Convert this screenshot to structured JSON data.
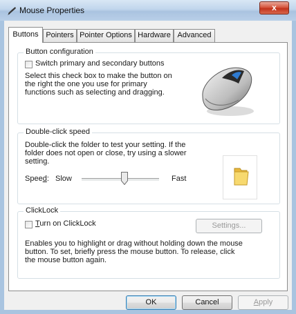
{
  "window": {
    "title": "Mouse Properties",
    "close_label": "x"
  },
  "tabs": [
    {
      "label": "Buttons",
      "active": true
    },
    {
      "label": "Pointers",
      "active": false
    },
    {
      "label": "Pointer Options",
      "active": false
    },
    {
      "label": "Hardware",
      "active": false
    },
    {
      "label": "Advanced",
      "active": false
    }
  ],
  "button_configuration": {
    "title": "Button configuration",
    "checkbox_label": "Switch primary and secondary buttons",
    "checkbox_checked": false,
    "description": "Select this check box to make the button on the right the one you use for primary functions such as selecting and dragging."
  },
  "double_click": {
    "title": "Double-click speed",
    "description": "Double-click the folder to test your setting. If the folder does not open or close, try using a slower setting.",
    "speed_label_rest": "Spee",
    "speed_label_ul": "d",
    "speed_label_colon": ":",
    "slow_label": "Slow",
    "fast_label": "Fast",
    "speed_level_fraction": 0.55
  },
  "clicklock": {
    "title": "ClickLock",
    "checkbox_label_ul": "T",
    "checkbox_label_rest": "urn on ClickLock",
    "checkbox_checked": false,
    "settings_label": "Settings...",
    "description": "Enables you to highlight or drag without holding down the mouse button. To set, briefly press the mouse button. To release, click the mouse button again."
  },
  "footer": {
    "ok_label": "OK",
    "cancel_label": "Cancel",
    "apply_label": "Apply"
  },
  "icons": {
    "title": "mouse-pointer-icon",
    "mouse": "mouse-icon",
    "folder": "folder-icon"
  },
  "colors": {
    "titlebar": "#c0d5ec",
    "close": "#c2331d",
    "default_button_border": "#3c7fb1",
    "folder": "#f5d56a"
  }
}
